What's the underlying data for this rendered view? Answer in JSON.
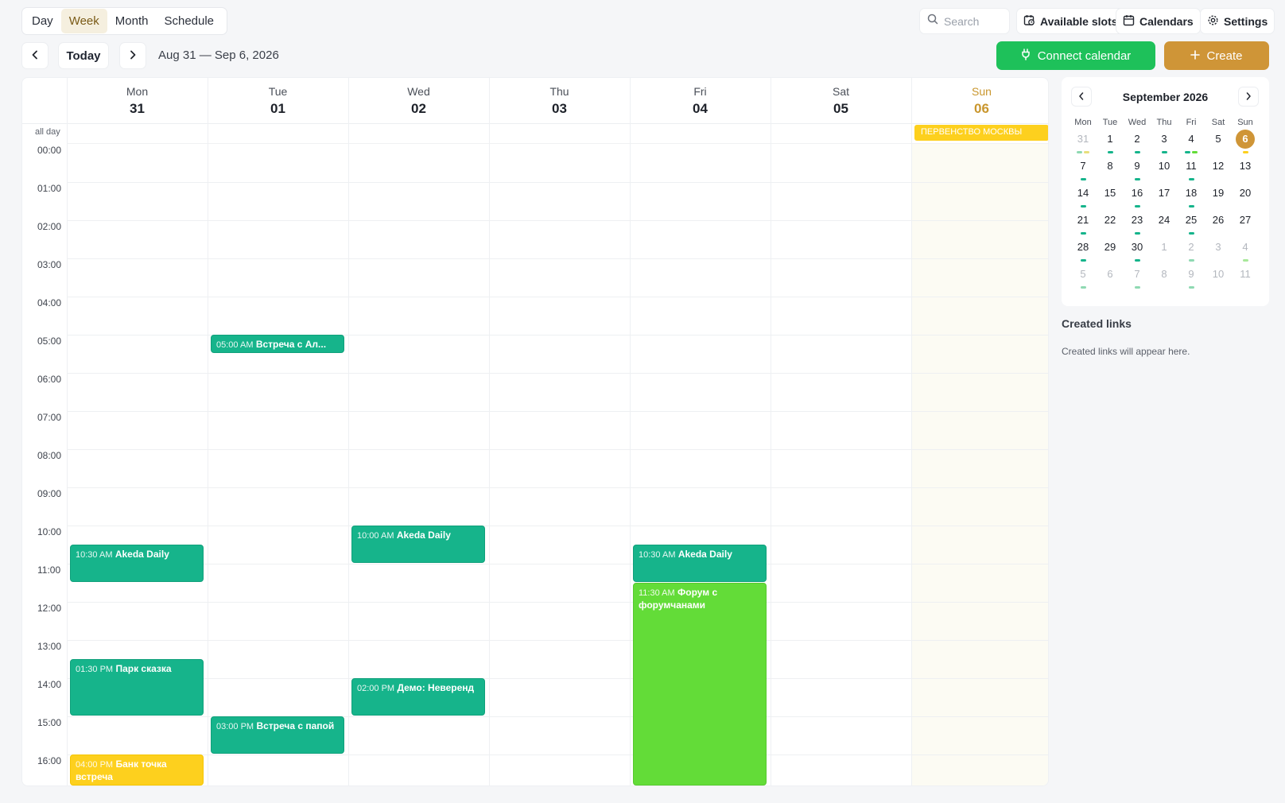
{
  "view_tabs": [
    {
      "label": "Day"
    },
    {
      "label": "Week"
    },
    {
      "label": "Month"
    },
    {
      "label": "Schedule"
    }
  ],
  "active_tab": "Week",
  "search": {
    "placeholder": "Search"
  },
  "toolbar": {
    "available_slots": "Available slots",
    "calendars": "Calendars",
    "settings": "Settings",
    "today": "Today",
    "date_range": "Aug 31 — Sep 6, 2026",
    "connect_calendar": "Connect calendar",
    "create": "Create"
  },
  "colors": {
    "accent": "#cf9537",
    "connect": "#1ec15a",
    "event_teal": "#16b48b",
    "event_lime": "#63dc38",
    "event_yellow": "#fdd01e"
  },
  "week": {
    "days": [
      {
        "name": "Mon",
        "date": "31"
      },
      {
        "name": "Tue",
        "date": "01"
      },
      {
        "name": "Wed",
        "date": "02"
      },
      {
        "name": "Thu",
        "date": "03"
      },
      {
        "name": "Fri",
        "date": "04"
      },
      {
        "name": "Sat",
        "date": "05"
      },
      {
        "name": "Sun",
        "date": "06",
        "today": true
      }
    ],
    "all_day_label": "all day",
    "hours": [
      "00:00",
      "01:00",
      "02:00",
      "03:00",
      "04:00",
      "05:00",
      "06:00",
      "07:00",
      "08:00",
      "09:00",
      "10:00",
      "11:00",
      "12:00",
      "13:00",
      "14:00",
      "15:00",
      "16:00"
    ],
    "all_day_events": [
      {
        "title": "ПЕРВЕНСТВО МОСКВЫ",
        "day": 6,
        "color": "yellow"
      }
    ],
    "events": [
      {
        "day": 1,
        "time": "05:00 AM",
        "title": "Встреча с Ал...",
        "start": 5.0,
        "end": 5.5,
        "color": "teal"
      },
      {
        "day": 0,
        "time": "10:30 AM",
        "title": "Akeda Daily",
        "start": 10.5,
        "end": 11.5,
        "color": "teal"
      },
      {
        "day": 2,
        "time": "10:00 AM",
        "title": "Akeda Daily",
        "start": 10.0,
        "end": 11.0,
        "color": "teal"
      },
      {
        "day": 4,
        "time": "10:30 AM",
        "title": "Akeda Daily",
        "start": 10.5,
        "end": 11.5,
        "color": "teal"
      },
      {
        "day": 4,
        "time": "11:30 AM",
        "title": "Форум с форумчанами",
        "start": 11.5,
        "end": 17.0,
        "color": "lime"
      },
      {
        "day": 0,
        "time": "01:30 PM",
        "title": "Парк сказка",
        "start": 13.5,
        "end": 15.0,
        "color": "teal"
      },
      {
        "day": 2,
        "time": "02:00 PM",
        "title": "Демо: Неверенд",
        "start": 14.0,
        "end": 15.0,
        "color": "teal"
      },
      {
        "day": 1,
        "time": "03:00 PM",
        "title": "Встреча с папой",
        "start": 15.0,
        "end": 16.0,
        "color": "teal"
      },
      {
        "day": 0,
        "time": "04:00 PM",
        "title": "Банк точка встреча",
        "start": 16.0,
        "end": 17.0,
        "color": "yellow"
      }
    ]
  },
  "mini_calendar": {
    "title": "September 2026",
    "weekdays": [
      "Mon",
      "Tue",
      "Wed",
      "Thu",
      "Fri",
      "Sat",
      "Sun"
    ],
    "weeks": [
      [
        {
          "d": "31",
          "muted": true,
          "dots": [
            "#8fd9b2",
            "#e8df7c"
          ]
        },
        {
          "d": "1",
          "dots": [
            "#16b48b"
          ]
        },
        {
          "d": "2",
          "dots": [
            "#16b48b"
          ]
        },
        {
          "d": "3",
          "dots": [
            "#16b48b"
          ]
        },
        {
          "d": "4",
          "dots": [
            "#16b48b",
            "#63dc38"
          ]
        },
        {
          "d": "5"
        },
        {
          "d": "6",
          "selected": true,
          "dots": [
            "#fdd01e"
          ]
        }
      ],
      [
        {
          "d": "7",
          "dots": [
            "#16b48b"
          ]
        },
        {
          "d": "8"
        },
        {
          "d": "9",
          "dots": [
            "#16b48b"
          ]
        },
        {
          "d": "10"
        },
        {
          "d": "11",
          "dots": [
            "#16b48b"
          ]
        },
        {
          "d": "12"
        },
        {
          "d": "13"
        }
      ],
      [
        {
          "d": "14",
          "dots": [
            "#16b48b"
          ]
        },
        {
          "d": "15"
        },
        {
          "d": "16",
          "dots": [
            "#16b48b"
          ]
        },
        {
          "d": "17"
        },
        {
          "d": "18",
          "dots": [
            "#16b48b"
          ]
        },
        {
          "d": "19"
        },
        {
          "d": "20"
        }
      ],
      [
        {
          "d": "21",
          "dots": [
            "#16b48b"
          ]
        },
        {
          "d": "22"
        },
        {
          "d": "23",
          "dots": [
            "#16b48b"
          ]
        },
        {
          "d": "24"
        },
        {
          "d": "25",
          "dots": [
            "#16b48b"
          ]
        },
        {
          "d": "26"
        },
        {
          "d": "27"
        }
      ],
      [
        {
          "d": "28",
          "dots": [
            "#16b48b"
          ]
        },
        {
          "d": "29"
        },
        {
          "d": "30",
          "dots": [
            "#16b48b"
          ]
        },
        {
          "d": "1",
          "muted": true
        },
        {
          "d": "2",
          "muted": true,
          "dots": [
            "#8fd9b2"
          ]
        },
        {
          "d": "3",
          "muted": true
        },
        {
          "d": "4",
          "muted": true,
          "dots": [
            "#a8e89a"
          ]
        }
      ],
      [
        {
          "d": "5",
          "muted": true,
          "dots": [
            "#8fd9b2"
          ]
        },
        {
          "d": "6",
          "muted": true
        },
        {
          "d": "7",
          "muted": true,
          "dots": [
            "#8fd9b2"
          ]
        },
        {
          "d": "8",
          "muted": true
        },
        {
          "d": "9",
          "muted": true,
          "dots": [
            "#8fd9b2"
          ]
        },
        {
          "d": "10",
          "muted": true
        },
        {
          "d": "11",
          "muted": true
        }
      ]
    ]
  },
  "links": {
    "title": "Created links",
    "empty_text": "Created links will appear here."
  }
}
